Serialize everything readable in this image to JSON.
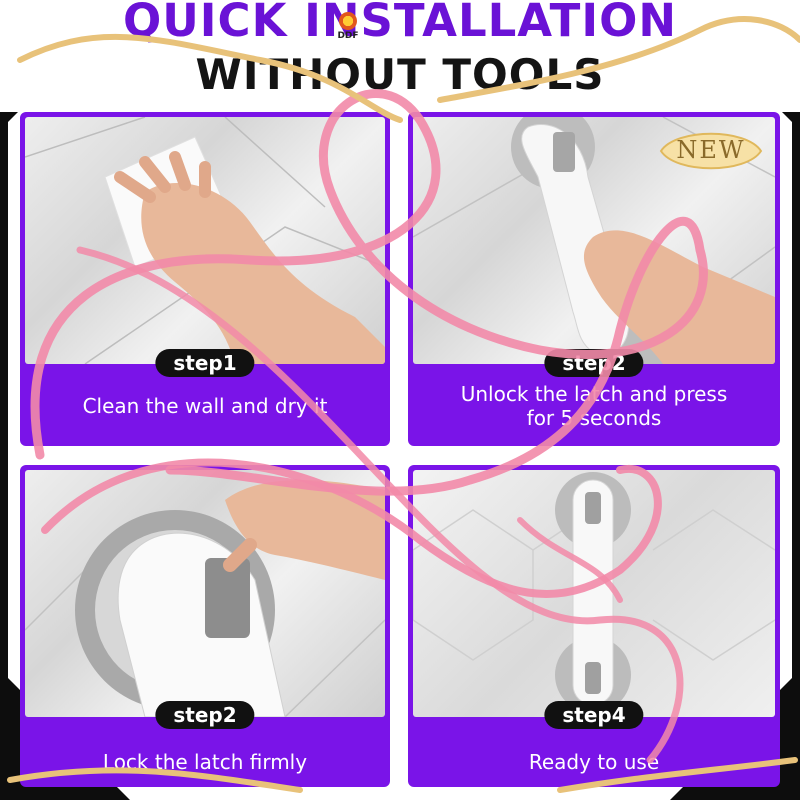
{
  "header": {
    "title_line1": "QUICK INSTALLATION",
    "title_line2": "WITHOUT TOOLS",
    "brand": "DDF"
  },
  "badge": {
    "label": "NEW"
  },
  "steps": [
    {
      "pill": "step1",
      "caption": "Clean the wall and dry it"
    },
    {
      "pill": "step2",
      "caption_line1": "Unlock the latch and press",
      "caption_line2": "for 5 seconds"
    },
    {
      "pill": "step2",
      "caption": "Lock the latch firmly"
    },
    {
      "pill": "step4",
      "caption": "Ready to use"
    }
  ],
  "colors": {
    "panel": "#7a14e8",
    "title": "#6a12d6",
    "ribbon_pink": "#f28aa8",
    "ribbon_gold": "#e8c27a"
  },
  "icons": [
    "wipe-hand-icon",
    "grab-bar-icon",
    "latch-icon",
    "grab-bar-icon"
  ]
}
